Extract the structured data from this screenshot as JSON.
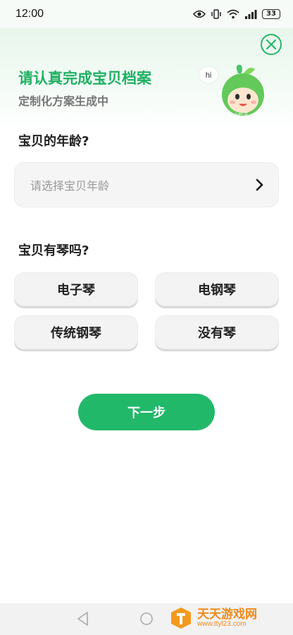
{
  "status_bar": {
    "time": "12:00",
    "battery": "33"
  },
  "header": {
    "title": "请认真完成宝贝档案",
    "subtitle": "定制化方案生成中",
    "bubble": "hi",
    "mascot_label": "小叶子"
  },
  "age_section": {
    "label": "宝贝的年龄?",
    "placeholder": "请选择宝贝年龄"
  },
  "piano_section": {
    "label": "宝贝有琴吗?",
    "options": [
      "电子琴",
      "电钢琴",
      "传统钢琴",
      "没有琴"
    ]
  },
  "next_button": "下一步",
  "watermark": {
    "title": "天天游戏网",
    "url": "www.ttyl23.com"
  },
  "colors": {
    "accent": "#22b86a",
    "title": "#1fb163"
  },
  "icons": [
    "eye-icon",
    "vibrate-icon",
    "wifi-icon",
    "signal-icon",
    "battery-icon",
    "close-icon",
    "chevron-right-icon",
    "nav-back-icon",
    "nav-home-icon"
  ]
}
